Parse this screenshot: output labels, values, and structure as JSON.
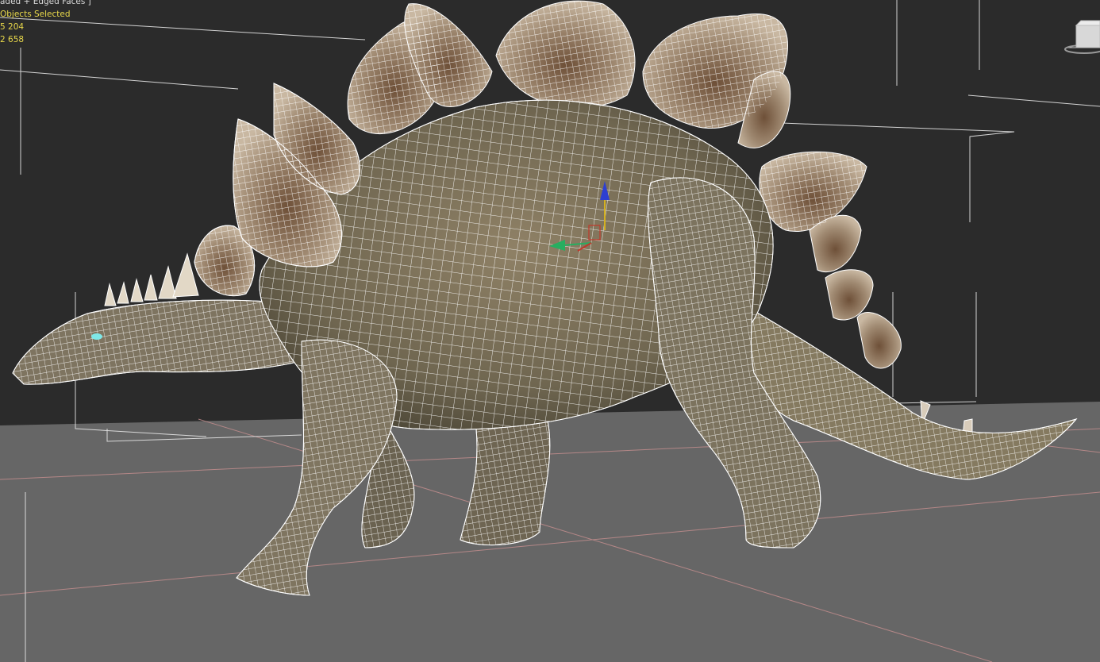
{
  "viewport": {
    "shading_mode": "aded + Edged Faces ]",
    "stats": {
      "selection": "Objects Selected",
      "polys": "5 204",
      "verts": "2 658"
    }
  },
  "scene": {
    "object": "stegosaurus-model",
    "colors": {
      "background": "#2b2b2b",
      "ground": "#666666",
      "grid_line": "#c89090",
      "wire": "#ffffff",
      "skin": "#8a7d62",
      "plates": "#b9a48a",
      "gizmo_x": "#c0392b",
      "gizmo_y": "#27ae60",
      "gizmo_z": "#2d3fd1"
    }
  },
  "viewcube": {
    "icon": "viewcube-icon"
  }
}
